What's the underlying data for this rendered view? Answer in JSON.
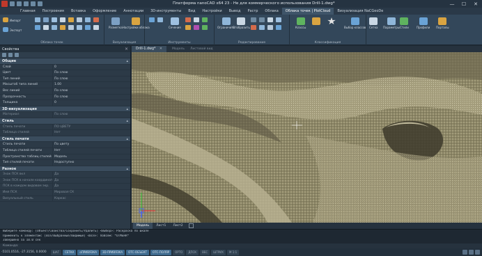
{
  "window": {
    "title": "Платформа nanoCAD x64 23 - Не для коммерческого использования Drill-1.dwg*",
    "minimize_glyph": "—",
    "maximize_glyph": "☐",
    "close_glyph": "✕"
  },
  "tabs": [
    {
      "label": "Главная"
    },
    {
      "label": "Построения"
    },
    {
      "label": "Вставка"
    },
    {
      "label": "Оформление"
    },
    {
      "label": "Аннотации"
    },
    {
      "label": "3D-инструменты"
    },
    {
      "label": "Вид"
    },
    {
      "label": "Настройки"
    },
    {
      "label": "Вывод"
    },
    {
      "label": "Растр"
    },
    {
      "label": "Облака"
    },
    {
      "label": "Облака точек | PlotCloud"
    },
    {
      "label": "Визуализация NaCGeoDe"
    }
  ],
  "active_tab_index": 11,
  "ribbon": {
    "group_labels": [
      "Облако точек",
      "Визуализация",
      "Инструменты",
      "Редактирование",
      "Классификация"
    ],
    "button_labels": [
      "Импорт",
      "Экспорт",
      "Разметка",
      "Настройки облака",
      "Поиск",
      "Группа",
      "Сечения",
      "Привязка",
      "Ограничить",
      "Отобразить",
      "Классы",
      "Выбор классов",
      "Сетка",
      "Параметры",
      "Стили",
      "Профили",
      "Порталы"
    ]
  },
  "properties": {
    "title": "Свойства",
    "rows": [
      {
        "type": "section",
        "label": "Общие"
      },
      {
        "type": "row",
        "k": "Слой",
        "v": "0"
      },
      {
        "type": "row",
        "k": "Цвет",
        "v": "По слою"
      },
      {
        "type": "row",
        "k": "Тип линий",
        "v": "По слою"
      },
      {
        "type": "row",
        "k": "Масштаб типа линий",
        "v": "1.00"
      },
      {
        "type": "row",
        "k": "Вес линий",
        "v": "По слою"
      },
      {
        "type": "row",
        "k": "Прозрачность",
        "v": "По слою"
      },
      {
        "type": "row",
        "k": "Толщина",
        "v": "0"
      },
      {
        "type": "section",
        "label": "3D-визуализация"
      },
      {
        "type": "row",
        "k": "Материал",
        "v": "По слою",
        "dim": true
      },
      {
        "type": "section",
        "label": "Стиль"
      },
      {
        "type": "row",
        "k": "Стиль печати",
        "v": "ПО ЦВЕТУ",
        "dim": true
      },
      {
        "type": "row",
        "k": "Таблица стилей",
        "v": "Нет",
        "dim": true
      },
      {
        "type": "section",
        "label": "Стиль печати"
      },
      {
        "type": "row",
        "k": "Стиль печати",
        "v": "По цвету"
      },
      {
        "type": "row",
        "k": "Таблица стилей печати",
        "v": "Нет"
      },
      {
        "type": "row",
        "k": "Пространство таблиц стилей п...",
        "v": "Модель"
      },
      {
        "type": "row",
        "k": "Тип стилей печати",
        "v": "Недоступно"
      },
      {
        "type": "section",
        "label": "Разное"
      },
      {
        "type": "row",
        "k": "Знак ПСК вкл",
        "v": "Да",
        "dim": true
      },
      {
        "type": "row",
        "k": "Знак ПСК в начале координат",
        "v": "Да",
        "dim": true
      },
      {
        "type": "row",
        "k": "ПСК в каждом видовом экр.",
        "v": "Да",
        "dim": true
      },
      {
        "type": "row",
        "k": "Имя ПСК",
        "v": "Мировая СК",
        "dim": true
      },
      {
        "type": "row",
        "k": "Визуальный стиль",
        "v": "Каркас",
        "dim": true
      }
    ]
  },
  "viewport": {
    "doc_tab": "Drill-1.dwg*",
    "doc_close": "✕",
    "sub_labels": [
      "Модель",
      "Листовой вид"
    ]
  },
  "layout_tabs": [
    "Модель",
    "Лист1",
    "Лист2"
  ],
  "active_layout_index": 0,
  "command_line": {
    "lines": [
      "Выберите команду: [Объект/Свойства/Сохранить/Удалить] <Выбор>: Раскраска по шкале",
      "Применить к элементам: [Все/Выбранные/Видимые] <Все>: ПоВсем: *ОТМЕНА*",
      "Завершено за 10.0 сек"
    ],
    "prompt": "Команда:"
  },
  "status_bar": {
    "coords": "-5101.0516, -27.3156, 0.0000",
    "buttons": [
      {
        "label": "ШАГ",
        "on": false
      },
      {
        "label": "СЕТКА",
        "on": true
      },
      {
        "label": "оПРИВЯЗКА",
        "on": true
      },
      {
        "label": "3D-ПРИВЯЗКА",
        "on": true
      },
      {
        "label": "ОТС-ОБЪЕКТ",
        "on": true
      },
      {
        "label": "ОТС-ПОЛЯР",
        "on": true
      },
      {
        "label": "ОРТО",
        "on": false
      },
      {
        "label": "ДПСК",
        "on": false
      },
      {
        "label": "ВЕС",
        "on": false
      },
      {
        "label": "ШТРИХ",
        "on": false
      },
      {
        "label": "M 1:1",
        "on": false
      }
    ]
  },
  "colors": {
    "accent": "#3e6a8e",
    "terrain_light": "#a39d7d",
    "terrain_dark": "#4a4634",
    "ucs_x": "#e04040",
    "ucs_y": "#40c040",
    "ucs_z": "#4060ff"
  }
}
